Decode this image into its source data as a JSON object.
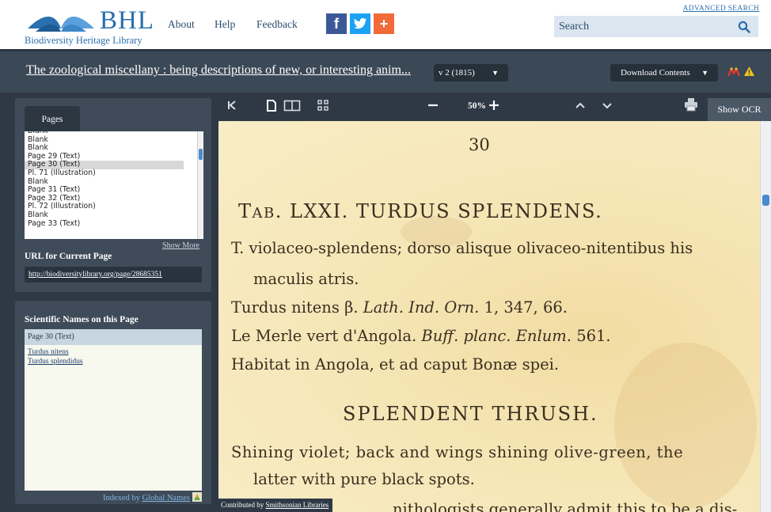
{
  "header": {
    "logo_text": "BHL",
    "logo_subtitle": "Biodiversity Heritage Library",
    "nav": [
      "About",
      "Help",
      "Feedback"
    ],
    "social": [
      {
        "name": "facebook",
        "glyph": "f",
        "color": "#3b5998"
      },
      {
        "name": "twitter",
        "glyph": "t",
        "color": "#1da1f2"
      },
      {
        "name": "share",
        "glyph": "+",
        "color": "#f26a3a"
      }
    ],
    "advanced_search": "ADVANCED SEARCH",
    "search_placeholder": "Search",
    "search_icon": "magnifier-icon"
  },
  "titlebar": {
    "book_title": "The zoological miscellany : being descriptions of new, or interesting anim...",
    "volume": "v 2 (1815)",
    "download": "Download Contents",
    "icons": [
      "altmetric-icon",
      "warning-icon"
    ]
  },
  "pages_panel": {
    "tab": "Pages",
    "items": [
      "Blank",
      "Blank",
      "Blank",
      "Page 29 (Text)",
      "Page 30 (Text)",
      "Pl. 71 (Illustration)",
      "Blank",
      "Page 31 (Text)",
      "Page 32 (Text)",
      "Pl. 72 (Illustration)",
      "Blank",
      "Page 33 (Text)"
    ],
    "selected_index": 4,
    "show_more": "Show More",
    "url_label": "URL for Current Page",
    "url": "http://biodiversitylibrary.org/page/28685351"
  },
  "names_panel": {
    "title": "Scientific Names on this Page",
    "page_label": "Page 30 (Text)",
    "names": [
      "Turdus nitens",
      "Turdus splendidus"
    ],
    "indexed_by": "Indexed by",
    "indexed_link": "Global Names"
  },
  "toolbar": {
    "icons": [
      "first-page-icon",
      "single-page-icon",
      "two-page-icon",
      "grid-view-icon",
      "zoom-out-icon",
      "zoom-in-icon",
      "prev-page-icon",
      "next-page-icon",
      "print-icon"
    ],
    "zoom": "50%",
    "show_ocr": "Show OCR"
  },
  "page_text": {
    "page_number": "30",
    "tab_prefix": "T",
    "tab_sc": "AB",
    "tab_rest": ". LXXI. TURDUS SPLENDENS.",
    "line1": "T. violaceo-splendens; dorso alisque olivaceo-nitentibus his",
    "line2": "maculis atris.",
    "line3a": "Turdus nitens β.",
    "line3b": "Lath. Ind. Orn.",
    "line3c": "1, 347, 66.",
    "line4a": "Le Merle vert d'Angola.",
    "line4b": "Buff. planc. Enlum.",
    "line4c": "561.",
    "line5": "Habitat in Angola, et ad caput Bonæ spei.",
    "heading": "SPLENDENT THRUSH.",
    "line6": "Shining violet; back and wings shining olive-green, the",
    "line7": "latter with pure black spots.",
    "line8": "nithologists generally admit this to be a dis-"
  },
  "contributed": {
    "prefix": "Contributed by",
    "link": "Smithsonian Libraries"
  },
  "colors": {
    "brand_blue": "#2a6fae",
    "bar_dark": "#3b4856",
    "panel_dark": "#2e3945",
    "paper": "#f6e6b6"
  }
}
